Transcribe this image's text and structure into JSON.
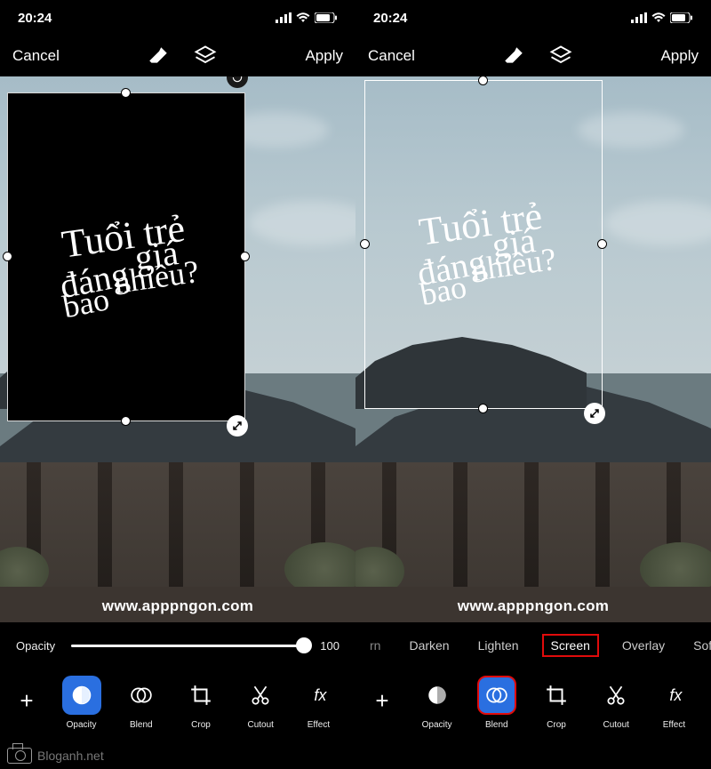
{
  "status": {
    "time": "20:24"
  },
  "topbar": {
    "cancel": "Cancel",
    "apply": "Apply"
  },
  "overlay_text": {
    "line1": "Tuổi trẻ",
    "line2_a": "đáng",
    "line2_b": "giá",
    "line3_a": "bao",
    "line3_b": "nhiêu?"
  },
  "watermark": "www.apppngon.com",
  "slider": {
    "label": "Opacity",
    "value": "100",
    "percent": 100
  },
  "blend_modes": {
    "items": [
      "rn",
      "Darken",
      "Lighten",
      "Screen",
      "Overlay",
      "Soft Light"
    ],
    "selected_index": 3
  },
  "tools": {
    "plus": "+",
    "items": [
      {
        "id": "opacity",
        "label": "Opacity"
      },
      {
        "id": "blend",
        "label": "Blend"
      },
      {
        "id": "crop",
        "label": "Crop"
      },
      {
        "id": "cutout",
        "label": "Cutout"
      },
      {
        "id": "effects",
        "label": "Effect"
      }
    ],
    "left_active_index": 0,
    "right_active_index": 1
  },
  "footer_brand": "Bloganh.net"
}
